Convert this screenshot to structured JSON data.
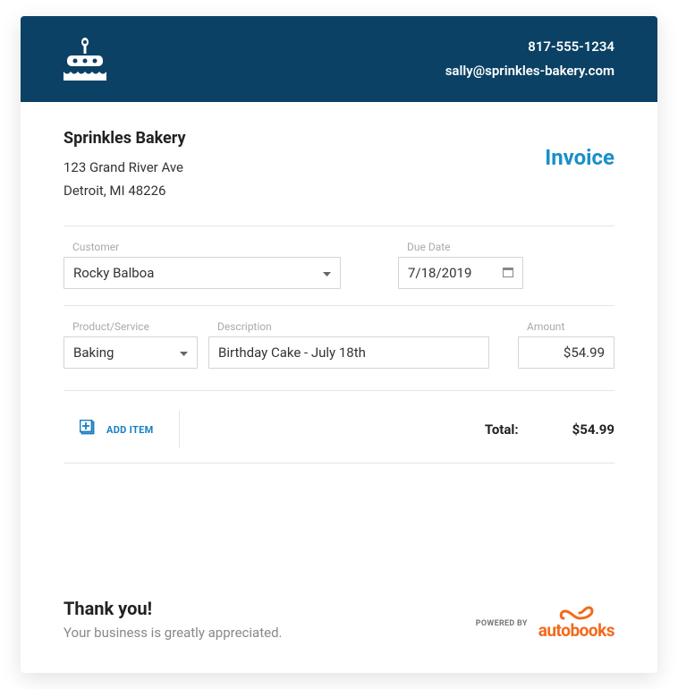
{
  "header": {
    "phone": "817-555-1234",
    "email": "sally@sprinkles-bakery.com"
  },
  "company": {
    "name": "Sprinkles Bakery",
    "address": "123 Grand River Ave",
    "city_state_zip": "Detroit, MI 48226"
  },
  "invoice_title": "Invoice",
  "labels": {
    "customer": "Customer",
    "due_date": "Due Date",
    "product": "Product/Service",
    "description": "Description",
    "amount": "Amount",
    "add_item": "ADD ITEM",
    "total": "Total:"
  },
  "customer": "Rocky Balboa",
  "due_date": "7/18/2019",
  "line_item": {
    "product": "Baking",
    "description": "Birthday Cake - July 18th",
    "amount": "$54.99"
  },
  "total": "$54.99",
  "footer": {
    "thank_you": "Thank you!",
    "sub": "Your business is greatly appreciated.",
    "powered_by": "POWERED BY",
    "brand": "autobooks"
  }
}
